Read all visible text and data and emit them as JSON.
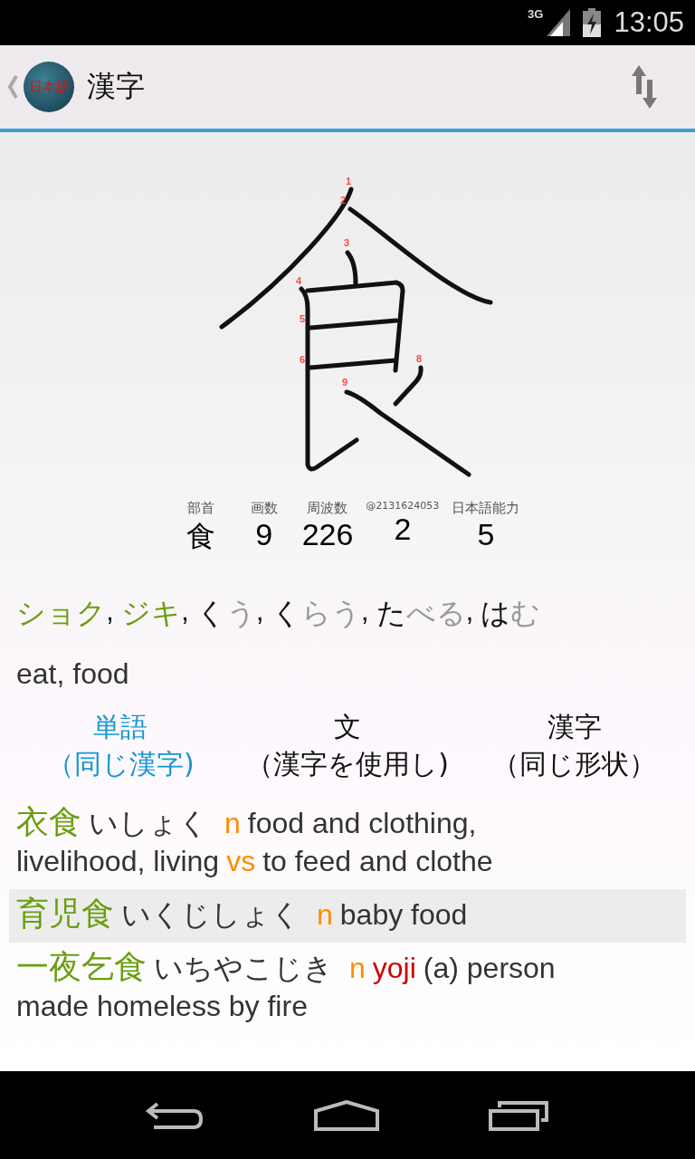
{
  "status_bar": {
    "network": "3G",
    "time": "13:05"
  },
  "app_bar": {
    "logo_text": "日本語",
    "title": "漢字"
  },
  "stroke_numbers": [
    "1",
    "2",
    "3",
    "4",
    "5",
    "6",
    "8",
    "9"
  ],
  "info": [
    {
      "label": "部首",
      "value": "食",
      "kind": "kanji"
    },
    {
      "label": "画数",
      "value": "9",
      "kind": "number"
    },
    {
      "label": "周波数",
      "value": "226",
      "kind": "number"
    },
    {
      "label": "@2131624053",
      "value": "2",
      "kind": "number"
    },
    {
      "label": "日本語能力",
      "value": "5",
      "kind": "number"
    }
  ],
  "readings": [
    {
      "parts": [
        {
          "text": "ショク",
          "kind": "on"
        }
      ],
      "separator": ","
    },
    {
      "parts": [
        {
          "text": "ジキ",
          "kind": "on"
        }
      ],
      "separator": ","
    },
    {
      "parts": [
        {
          "text": "く",
          "kind": "kun"
        },
        {
          "text": "う",
          "kind": "okurigana"
        }
      ],
      "separator": ","
    },
    {
      "parts": [
        {
          "text": "く",
          "kind": "kun"
        },
        {
          "text": "らう",
          "kind": "okurigana"
        }
      ],
      "separator": ","
    },
    {
      "parts": [
        {
          "text": "た",
          "kind": "kun"
        },
        {
          "text": "べる",
          "kind": "okurigana"
        }
      ],
      "separator": ","
    },
    {
      "parts": [
        {
          "text": "は",
          "kind": "kun"
        },
        {
          "text": "む",
          "kind": "okurigana"
        }
      ]
    }
  ],
  "meaning": "eat, food",
  "tabs": [
    {
      "label": "単語",
      "sublabel": "（同じ漢字)",
      "selected": true
    },
    {
      "label": "文",
      "sublabel": "（漢字を使用し)",
      "selected": false
    },
    {
      "label": "漢字",
      "sublabel": "（同じ形状）",
      "selected": false
    }
  ],
  "entries": [
    {
      "word": "衣食",
      "reading": "いしょく",
      "selected": false,
      "definition": [
        {
          "kind": "pos",
          "text": "n"
        },
        {
          "kind": "text",
          "text": "food and clothing,"
        },
        {
          "kind": "text",
          "text": "livelihood, living"
        },
        {
          "kind": "pos",
          "text": "vs"
        },
        {
          "kind": "text",
          "text": "to feed and clothe"
        }
      ]
    },
    {
      "word": "育児食",
      "reading": "いくじしょく",
      "selected": true,
      "definition": [
        {
          "kind": "pos",
          "text": "n"
        },
        {
          "kind": "text",
          "text": "baby food"
        }
      ]
    },
    {
      "word": "一夜乞食",
      "reading": "いちやこじき",
      "selected": false,
      "definition": [
        {
          "kind": "pos",
          "text": "n"
        },
        {
          "kind": "field",
          "text": "yoji"
        },
        {
          "kind": "text",
          "text": "(a) person"
        },
        {
          "kind": "text",
          "text": "made homeless by fire"
        }
      ]
    }
  ]
}
